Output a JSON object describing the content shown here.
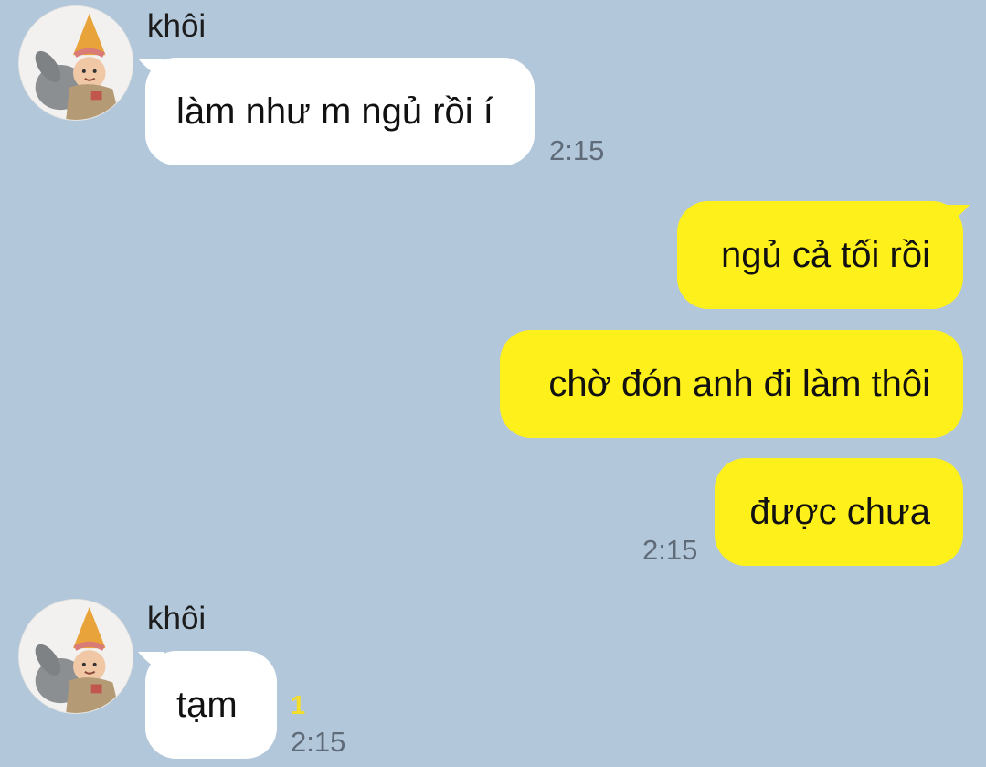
{
  "chat": {
    "groups": [
      {
        "sender": "khôi",
        "messages": [
          {
            "text": "làm như m ngủ rồi í",
            "time": "2:15"
          }
        ]
      },
      {
        "outgoing": true,
        "messages": [
          {
            "text": "ngủ cả tối rồi"
          },
          {
            "text": "chờ đón anh đi làm thôi"
          },
          {
            "text": "được chưa",
            "time": "2:15"
          }
        ]
      },
      {
        "sender": "khôi",
        "messages": [
          {
            "text": "tạm",
            "unread": "1",
            "time": "2:15"
          }
        ]
      }
    ]
  },
  "colors": {
    "background": "#b2c7da",
    "incoming_bubble": "#ffffff",
    "outgoing_bubble": "#fef01b",
    "time_text": "#5f6b78",
    "unread_count": "#f5dd2b"
  },
  "icons": {
    "avatar": "profile-photo-child-with-party-hat-and-rabbit"
  }
}
